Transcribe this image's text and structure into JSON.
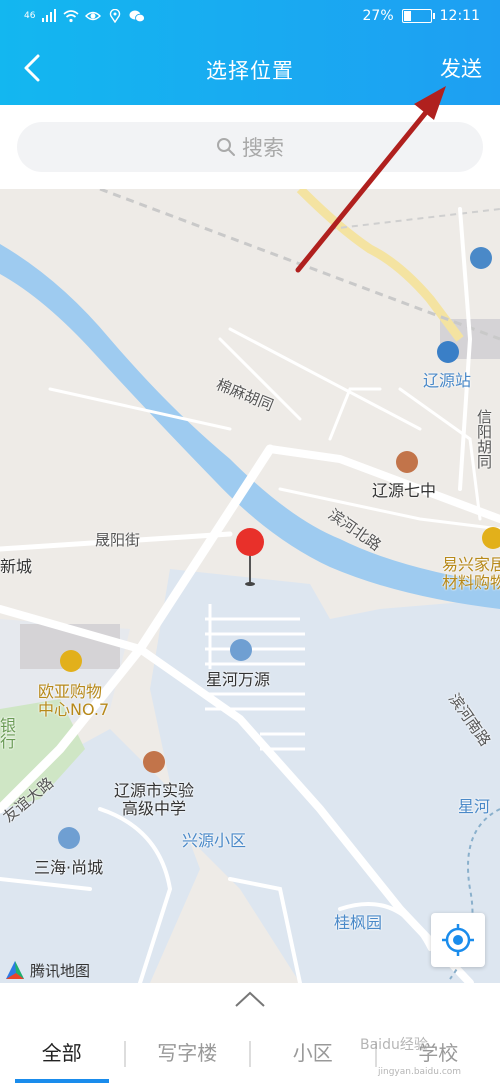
{
  "status_bar": {
    "signal_text": "46",
    "battery_percent": "27%",
    "battery_level": 0.27,
    "time": "12:11"
  },
  "header": {
    "title": "选择位置",
    "send_label": "发送",
    "back_icon": "chevron-left-icon"
  },
  "search": {
    "placeholder": "搜索"
  },
  "map": {
    "pois": {
      "liaoyuan_station": "辽源站",
      "mianma_hutong": "棉麻胡同",
      "liaoyuan_no7": "辽源七中",
      "binhe_north": "滨河北路",
      "yixing_line1": "易兴家居",
      "yixing_line2": "材料购物",
      "shengyang_street": "晟阳街",
      "xincheng": "新城",
      "xinghe_wanyuan": "星河万源",
      "ouya_line1": "欧亚购物",
      "ouya_line2": "中心NO.7",
      "binhe_south": "滨河南路",
      "school_line1": "辽源市实验",
      "school_line2": "高级中学",
      "youyi_road": "友谊大路",
      "xingyuan": "兴源小区",
      "sanhai": "三海·尚城",
      "xinghe_right": "星河",
      "guifeng": "桂枫园",
      "xinyang": "信阳胡同",
      "partial_left": "银行"
    },
    "logo_text": "腾讯地图",
    "locate_icon": "locate-icon",
    "pin_icon": "map-pin-icon"
  },
  "bottom": {
    "chevron_icon": "chevron-up-icon",
    "tabs": [
      "全部",
      "写字楼",
      "小区",
      "学校"
    ],
    "active_tab": 0
  },
  "watermark": {
    "text": "Baidu经验",
    "sub": "jingyan.baidu.com"
  },
  "colors": {
    "header_start": "#13b7f0",
    "header_end": "#1e9ff2",
    "annotation_arrow": "#b0201e",
    "pin": "#e8302a",
    "river": "#9ecbf0",
    "tab_indicator": "#1a8cec"
  }
}
